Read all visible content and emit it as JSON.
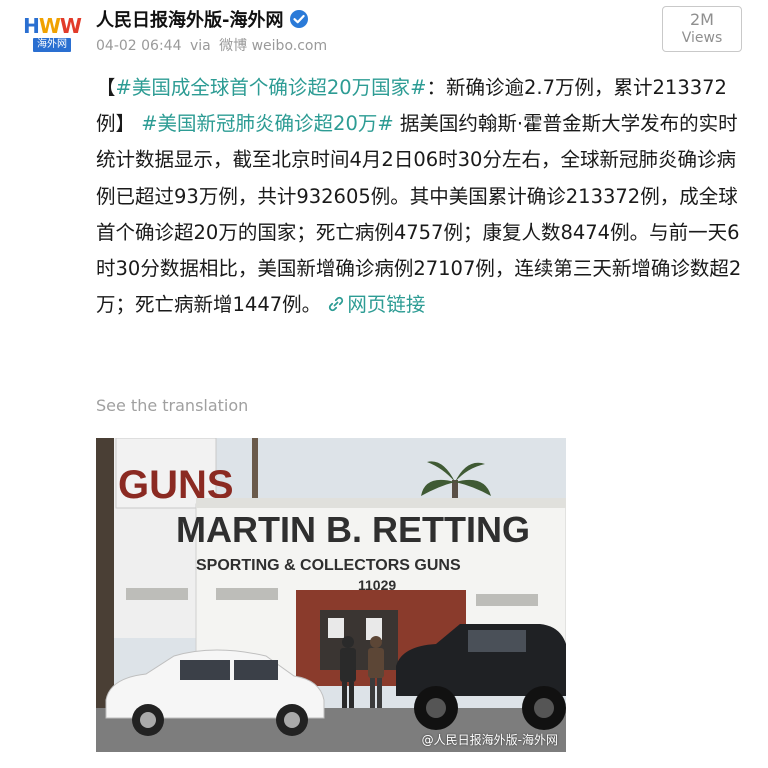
{
  "author": {
    "name": "人民日报海外版-海外网",
    "logo_top": "HWW",
    "logo_bottom": "海外网",
    "verified": true
  },
  "meta": {
    "timestamp": "04-02 06:44",
    "via": "via",
    "client": "微博 weibo.com"
  },
  "views": {
    "count": "2M",
    "label": "Views"
  },
  "post": {
    "bracket_open": "【",
    "tag1": "#美国成全球首个确诊超20万国家#",
    "text1": "：新确诊逾2.7万例，累计213372例】",
    "tag2": "#美国新冠肺炎确诊超20万#",
    "text2": " 据美国约翰斯·霍普金斯大学发布的实时统计数据显示，截至北京时间4月2日06时30分左右，全球新冠肺炎确诊病例已超过93万例，共计932605例。其中美国累计确诊213372例，成全球首个确诊超20万的国家；死亡病例4757例；康复人数8474例。与前一天6时30分数据相比，美国新增确诊病例27107例，连续第三天新增确诊数超2万；死亡病新增1447例。",
    "link_label": "网页链接"
  },
  "translate_label": "See the translation",
  "photo": {
    "sign_main": "MARTIN B. RETTING",
    "sign_sub": "SPORTING & COLLECTORS GUNS",
    "sign_number": "11029",
    "side_sign": "GUNS",
    "watermark": "@人民日报海外版-海外网"
  },
  "colors": {
    "tag": "#2d9c94",
    "verified": "#2a7ad8",
    "muted": "#9a9a9a"
  },
  "icons": {
    "verified": "verified-badge-icon",
    "link": "link-icon"
  }
}
